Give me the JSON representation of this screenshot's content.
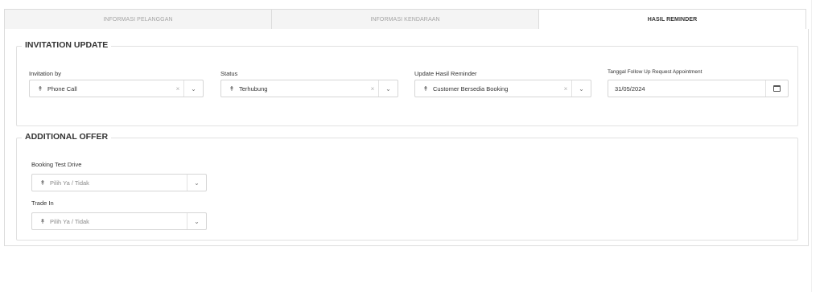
{
  "tabs": [
    {
      "label": "INFORMASI PELANGGAN"
    },
    {
      "label": "INFORMASI KENDARAAN"
    },
    {
      "label": "HASIL REMINDER"
    }
  ],
  "invitation_update": {
    "title": "INVITATION UPDATE",
    "invitation_by": {
      "label": "Invitation by",
      "value": "Phone Call",
      "clear": "×",
      "arrow": "⌄"
    },
    "status": {
      "label": "Status",
      "value": "Terhubung",
      "clear": "×",
      "arrow": "⌄"
    },
    "update_hasil": {
      "label": "Update Hasil Reminder",
      "value": "Customer Bersedia Booking",
      "clear": "×",
      "arrow": "⌄"
    },
    "follow_up": {
      "label": "Tanggal Follow Up Request Appointment",
      "value": "31/05/2024"
    }
  },
  "additional_offer": {
    "title": "ADDITIONAL OFFER",
    "booking_test_drive": {
      "label": "Booking Test Drive",
      "placeholder": "Pilih Ya / Tidak",
      "arrow": "⌄"
    },
    "trade_in": {
      "label": "Trade In",
      "placeholder": "Pilih Ya / Tidak",
      "arrow": "⌄"
    }
  },
  "icons": {
    "select_pin": "↟",
    "calendar": "calendar-icon"
  }
}
